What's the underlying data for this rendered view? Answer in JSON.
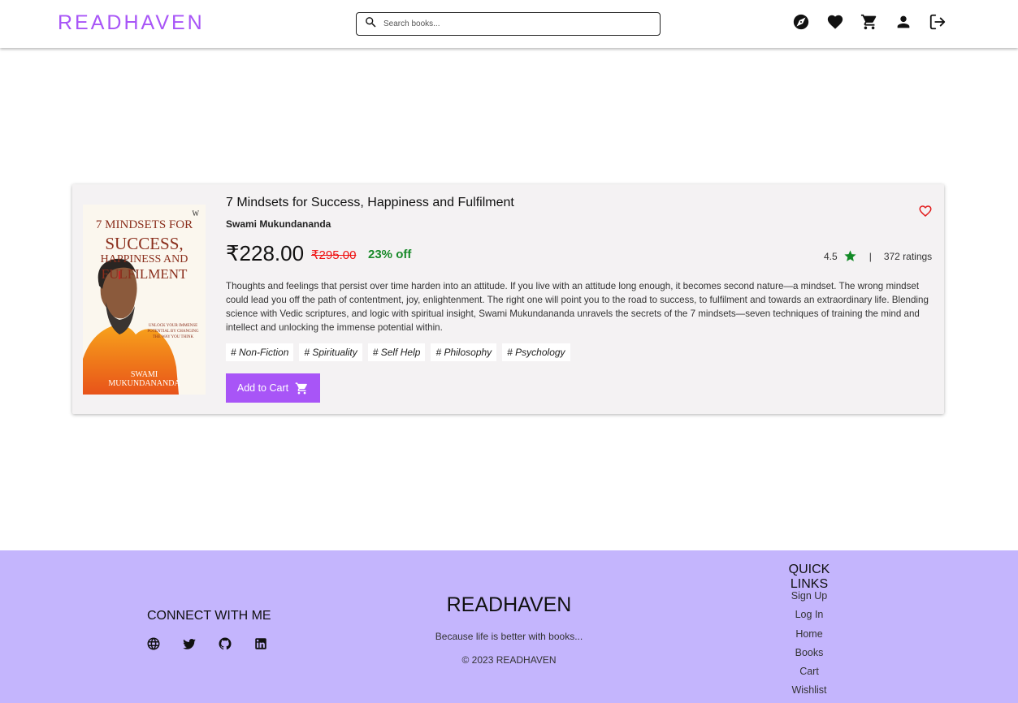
{
  "header": {
    "logo": "READHAVEN",
    "search_placeholder": "Search books...",
    "icons": [
      "explore-icon",
      "wishlist-icon",
      "cart-icon",
      "profile-icon",
      "logout-icon"
    ]
  },
  "book": {
    "title": "7 Mindsets for Success, Happiness and Fulfilment",
    "author": "Swami Mukundananda",
    "price": "₹228.00",
    "original_price": "₹295.00",
    "discount": "23% off",
    "rating": "4.5",
    "ratings_separator": "|",
    "ratings_count": "372 ratings",
    "description": "Thoughts and feelings that persist over time harden into an attitude. If you live with an attitude long enough, it becomes second nature—a mindset. The wrong mindset could lead you off the path of contentment, joy, enlightenment. The right one will point you to the road to success, to fulfilment and towards an extraordinary life. Blending science with Vedic scriptures, and logic with spiritual insight, Swami Mukundananda unravels the secrets of the 7 mindsets—seven techniques of training the mind and intellect and unlocking the immense potential within.",
    "tags": [
      "# Non-Fiction",
      "# Spirituality",
      "# Self Help",
      "# Philosophy",
      "# Psychology"
    ],
    "add_to_cart_label": "Add to Cart",
    "cover": {
      "line1": "7 MINDSETS FOR",
      "line2": "SUCCESS,",
      "line3": "HAPPINESS AND",
      "line4": "FULFILMENT",
      "tagline": "UNLOCK YOUR IMMENSE POTENTIAL BY CHANGING THE WAY YOU THINK",
      "author_line1": "SWAMI",
      "author_line2": "MUKUNDANANDA"
    }
  },
  "footer": {
    "connect_title": "CONNECT WITH ME",
    "social_icons": [
      "globe-icon",
      "twitter-icon",
      "github-icon",
      "linkedin-icon"
    ],
    "brand": "READHAVEN",
    "tagline": "Because life is better with books...",
    "copyright": "© 2023 READHAVEN",
    "quick_links_title": "QUICK LINKS",
    "quick_links": [
      "Sign Up",
      "Log In",
      "Home",
      "Books",
      "Cart",
      "Wishlist"
    ]
  },
  "colors": {
    "accent": "#a855f7",
    "footer_bg": "#c4b5fd",
    "card_bg": "#f4f2f3",
    "discount_green": "#198a2a",
    "mrp_red": "#ef1010",
    "heart_red": "#e11d1d",
    "star_green": "#128a26"
  }
}
